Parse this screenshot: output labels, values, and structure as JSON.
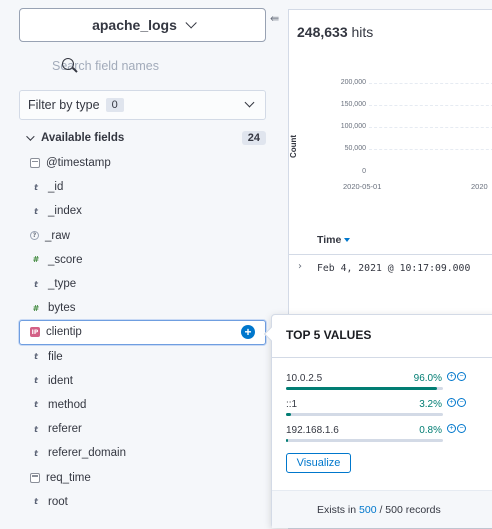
{
  "sidebar": {
    "index_pattern": "apache_logs",
    "search_placeholder": "Search field names",
    "filter_label": "Filter by type",
    "filter_count": "0",
    "available_label": "Available fields",
    "available_count": "24",
    "fields": [
      {
        "name": "@timestamp",
        "type": "date"
      },
      {
        "name": "_id",
        "type": "string"
      },
      {
        "name": "_index",
        "type": "string"
      },
      {
        "name": "_raw",
        "type": "unknown"
      },
      {
        "name": "_score",
        "type": "number"
      },
      {
        "name": "_type",
        "type": "string"
      },
      {
        "name": "bytes",
        "type": "number"
      },
      {
        "name": "clientip",
        "type": "ip"
      },
      {
        "name": "file",
        "type": "string"
      },
      {
        "name": "ident",
        "type": "string"
      },
      {
        "name": "method",
        "type": "string"
      },
      {
        "name": "referer",
        "type": "string"
      },
      {
        "name": "referer_domain",
        "type": "string"
      },
      {
        "name": "req_time",
        "type": "date"
      },
      {
        "name": "root",
        "type": "string"
      }
    ]
  },
  "main": {
    "hits_count": "248,633",
    "hits_label": "hits",
    "y_axis_label": "Count",
    "y_ticks": [
      "200,000",
      "150,000",
      "100,000",
      "50,000",
      "0"
    ],
    "x_ticks": [
      "2020-05-01",
      "2020"
    ],
    "time_col": "Time",
    "row_timestamp": "Feb 4, 2021 @ 10:17:09.000"
  },
  "popover": {
    "title": "TOP 5 VALUES",
    "values": [
      {
        "label": "10.0.2.5",
        "pct": "96.0%",
        "fraction": 0.96
      },
      {
        "label": "::1",
        "pct": "3.2%",
        "fraction": 0.032
      },
      {
        "label": "192.168.1.6",
        "pct": "0.8%",
        "fraction": 0.008
      }
    ],
    "visualize_label": "Visualize",
    "exists_prefix": "Exists in",
    "exists_link": "500",
    "exists_suffix": "/ 500 records"
  },
  "colors": {
    "accent": "#0077cc",
    "success": "#017d73",
    "ip_icon": "#d36086"
  }
}
